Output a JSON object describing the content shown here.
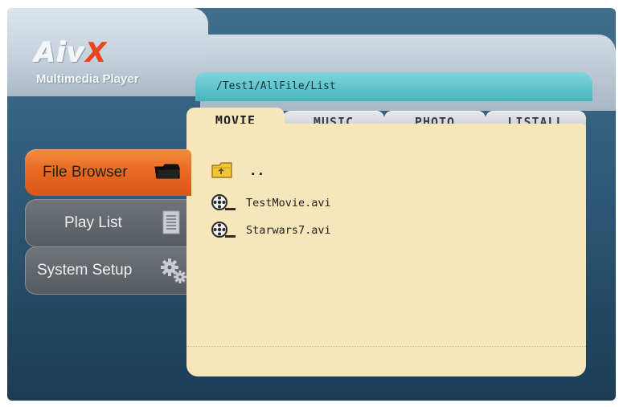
{
  "app": {
    "logo_text_main": "Aiv",
    "logo_text_x": "X",
    "subtitle": "Multimedia Player"
  },
  "path": "/Test1/AllFile/List",
  "tabs": [
    {
      "label": "MOVIE",
      "active": true
    },
    {
      "label": "MUSIC",
      "active": false
    },
    {
      "label": "PHOTO",
      "active": false
    },
    {
      "label": "LISTALL",
      "active": false
    }
  ],
  "menu": [
    {
      "label": "File Browser",
      "icon": "folder-icon",
      "selected": true
    },
    {
      "label": "Play List",
      "icon": "list-icon",
      "selected": false
    },
    {
      "label": "System Setup",
      "icon": "gears-icon",
      "selected": false
    }
  ],
  "files": [
    {
      "name": "..",
      "icon": "parent-folder-icon"
    },
    {
      "name": "TestMovie.avi",
      "icon": "film-reel-icon"
    },
    {
      "name": "Starwars7.avi",
      "icon": "film-reel-icon"
    }
  ],
  "colors": {
    "accent": "#e5661f",
    "panel": "#f7e6b9",
    "path_bar": "#48b3bd"
  }
}
